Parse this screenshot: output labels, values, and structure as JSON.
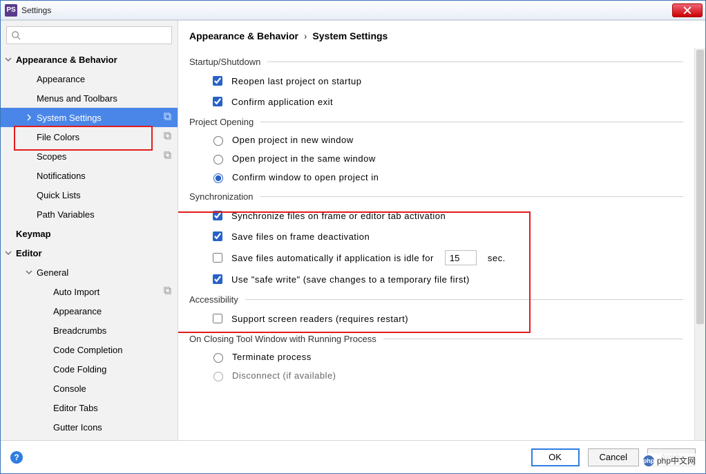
{
  "window": {
    "title": "Settings"
  },
  "search": {
    "placeholder": ""
  },
  "tree": {
    "appb": {
      "label": "Appearance & Behavior"
    },
    "appb_appearance": {
      "label": "Appearance"
    },
    "appb_menus": {
      "label": "Menus and Toolbars"
    },
    "appb_system": {
      "label": "System Settings"
    },
    "appb_filecolors": {
      "label": "File Colors"
    },
    "appb_scopes": {
      "label": "Scopes"
    },
    "appb_notifications": {
      "label": "Notifications"
    },
    "appb_quicklists": {
      "label": "Quick Lists"
    },
    "appb_pathvars": {
      "label": "Path Variables"
    },
    "keymap": {
      "label": "Keymap"
    },
    "editor": {
      "label": "Editor"
    },
    "editor_general": {
      "label": "General"
    },
    "eg_autoimport": {
      "label": "Auto Import"
    },
    "eg_appearance": {
      "label": "Appearance"
    },
    "eg_breadcrumbs": {
      "label": "Breadcrumbs"
    },
    "eg_codecompletion": {
      "label": "Code Completion"
    },
    "eg_codefolding": {
      "label": "Code Folding"
    },
    "eg_console": {
      "label": "Console"
    },
    "eg_editortabs": {
      "label": "Editor Tabs"
    },
    "eg_guttericons": {
      "label": "Gutter Icons"
    }
  },
  "breadcrumb": {
    "a": "Appearance & Behavior",
    "b": "System Settings"
  },
  "groups": {
    "startup": {
      "title": "Startup/Shutdown"
    },
    "opening": {
      "title": "Project Opening"
    },
    "sync": {
      "title": "Synchronization"
    },
    "accessibility": {
      "title": "Accessibility"
    },
    "closing": {
      "title": "On Closing Tool Window with Running Process"
    }
  },
  "opts": {
    "reopen": "Reopen last project on startup",
    "confirmExit": "Confirm application exit",
    "openNew": "Open project in new window",
    "openSame": "Open project in the same window",
    "openConfirm": "Confirm window to open project in",
    "syncActivate": "Synchronize files on frame or editor tab activation",
    "saveDeact": "Save files on frame deactivation",
    "saveIdlePre": "Save files automatically if application is idle for",
    "saveIdleVal": "15",
    "saveIdlePost": "sec.",
    "safeWrite": "Use \"safe write\" (save changes to a temporary file first)",
    "screenReaders": "Support screen readers (requires restart)",
    "terminate": "Terminate process",
    "disconnect": "Disconnect (if available)"
  },
  "footer": {
    "ok": "OK",
    "cancel": "Cancel",
    "apply": "Apply"
  },
  "watermark": {
    "text": "php中文网"
  }
}
